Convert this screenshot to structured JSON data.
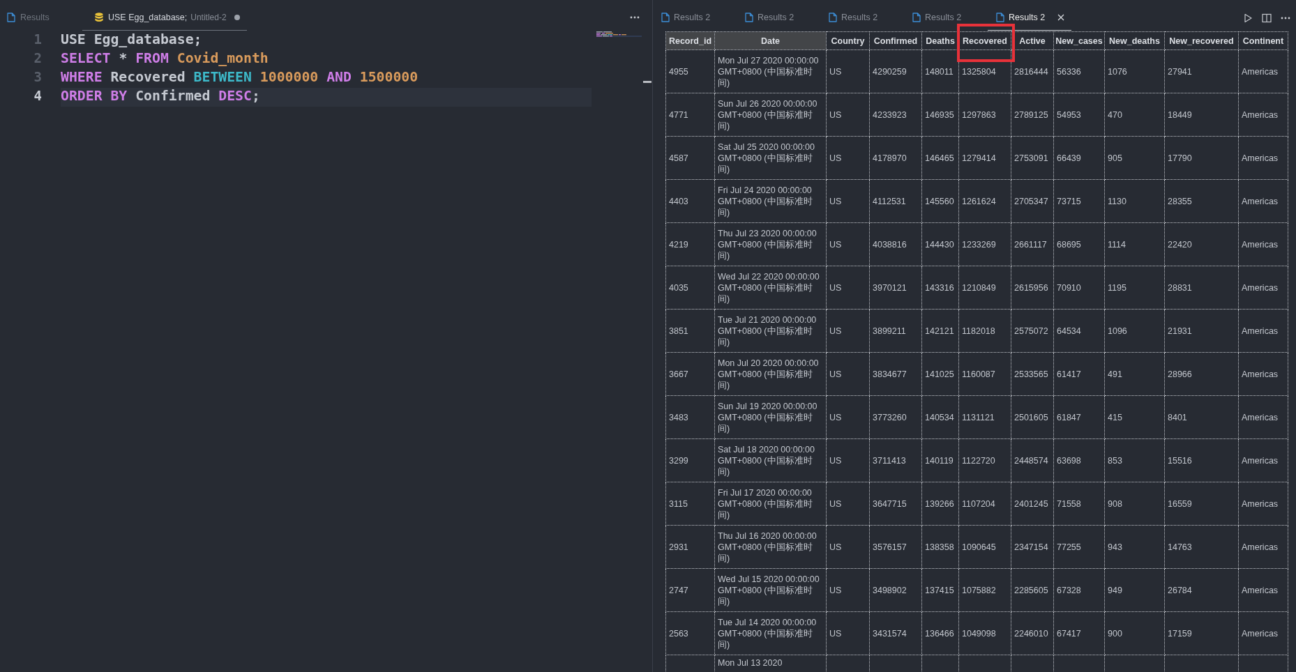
{
  "editor_tabs": [
    {
      "label": "Results",
      "kind": "results",
      "selected": false,
      "modified": false
    },
    {
      "label": "USE Egg_database;",
      "description": "Untitled-2",
      "kind": "query",
      "selected": true,
      "modified": true
    }
  ],
  "editor": {
    "lines": [
      {
        "number": "1",
        "current": false,
        "tokens": [
          {
            "text": "USE Egg_database;",
            "kind": "plain"
          }
        ]
      },
      {
        "number": "2",
        "current": false,
        "tokens": [
          {
            "text": "SELECT",
            "kind": "keyword"
          },
          {
            "text": " * ",
            "kind": "plain"
          },
          {
            "text": "FROM",
            "kind": "keyword"
          },
          {
            "text": " Covid_month",
            "kind": "name"
          }
        ]
      },
      {
        "number": "3",
        "current": false,
        "tokens": [
          {
            "text": "WHERE",
            "kind": "keyword"
          },
          {
            "text": " Recovered ",
            "kind": "plain"
          },
          {
            "text": "BETWEEN",
            "kind": "operator"
          },
          {
            "text": " 1000000",
            "kind": "number"
          },
          {
            "text": " AND",
            "kind": "keyword"
          },
          {
            "text": " 1500000",
            "kind": "number"
          }
        ]
      },
      {
        "number": "4",
        "current": true,
        "tokens": [
          {
            "text": "ORDER BY",
            "kind": "keyword"
          },
          {
            "text": " Confirmed ",
            "kind": "plain"
          },
          {
            "text": "DESC",
            "kind": "keyword"
          },
          {
            "text": ";",
            "kind": "plain"
          }
        ]
      }
    ]
  },
  "result_tabs": [
    {
      "label": "Results 2",
      "selected": false
    },
    {
      "label": "Results 2",
      "selected": false
    },
    {
      "label": "Results 2",
      "selected": false
    },
    {
      "label": "Results 2",
      "selected": false
    },
    {
      "label": "Results 2",
      "selected": true
    }
  ],
  "table": {
    "columns": [
      {
        "label": "Record_id",
        "shaded": true,
        "highlighted": false
      },
      {
        "label": "Date",
        "shaded": true,
        "highlighted": false
      },
      {
        "label": "Country",
        "shaded": false,
        "highlighted": false
      },
      {
        "label": "Confirmed",
        "shaded": false,
        "highlighted": false
      },
      {
        "label": "Deaths",
        "shaded": false,
        "highlighted": false
      },
      {
        "label": "Recovered",
        "shaded": false,
        "highlighted": true
      },
      {
        "label": "Active",
        "shaded": false,
        "highlighted": false
      },
      {
        "label": "New_cases",
        "shaded": false,
        "highlighted": false
      },
      {
        "label": "New_deaths",
        "shaded": false,
        "highlighted": false
      },
      {
        "label": "New_recovered",
        "shaded": false,
        "highlighted": false
      },
      {
        "label": "Continent",
        "shaded": false,
        "highlighted": false
      }
    ],
    "rows": [
      {
        "cells": [
          "4955",
          "Mon Jul 27 2020 00:00:00 GMT+0800 (中国标准时间)",
          "US",
          "4290259",
          "148011",
          "1325804",
          "2816444",
          "56336",
          "1076",
          "27941",
          "Americas"
        ]
      },
      {
        "cells": [
          "4771",
          "Sun Jul 26 2020 00:00:00 GMT+0800 (中国标准时间)",
          "US",
          "4233923",
          "146935",
          "1297863",
          "2789125",
          "54953",
          "470",
          "18449",
          "Americas"
        ]
      },
      {
        "cells": [
          "4587",
          "Sat Jul 25 2020 00:00:00 GMT+0800 (中国标准时间)",
          "US",
          "4178970",
          "146465",
          "1279414",
          "2753091",
          "66439",
          "905",
          "17790",
          "Americas"
        ]
      },
      {
        "cells": [
          "4403",
          "Fri Jul 24 2020 00:00:00 GMT+0800 (中国标准时间)",
          "US",
          "4112531",
          "145560",
          "1261624",
          "2705347",
          "73715",
          "1130",
          "28355",
          "Americas"
        ]
      },
      {
        "cells": [
          "4219",
          "Thu Jul 23 2020 00:00:00 GMT+0800 (中国标准时间)",
          "US",
          "4038816",
          "144430",
          "1233269",
          "2661117",
          "68695",
          "1114",
          "22420",
          "Americas"
        ]
      },
      {
        "cells": [
          "4035",
          "Wed Jul 22 2020 00:00:00 GMT+0800 (中国标准时间)",
          "US",
          "3970121",
          "143316",
          "1210849",
          "2615956",
          "70910",
          "1195",
          "28831",
          "Americas"
        ]
      },
      {
        "cells": [
          "3851",
          "Tue Jul 21 2020 00:00:00 GMT+0800 (中国标准时间)",
          "US",
          "3899211",
          "142121",
          "1182018",
          "2575072",
          "64534",
          "1096",
          "21931",
          "Americas"
        ]
      },
      {
        "cells": [
          "3667",
          "Mon Jul 20 2020 00:00:00 GMT+0800 (中国标准时间)",
          "US",
          "3834677",
          "141025",
          "1160087",
          "2533565",
          "61417",
          "491",
          "28966",
          "Americas"
        ]
      },
      {
        "cells": [
          "3483",
          "Sun Jul 19 2020 00:00:00 GMT+0800 (中国标准时间)",
          "US",
          "3773260",
          "140534",
          "1131121",
          "2501605",
          "61847",
          "415",
          "8401",
          "Americas"
        ]
      },
      {
        "cells": [
          "3299",
          "Sat Jul 18 2020 00:00:00 GMT+0800 (中国标准时间)",
          "US",
          "3711413",
          "140119",
          "1122720",
          "2448574",
          "63698",
          "853",
          "15516",
          "Americas"
        ]
      },
      {
        "cells": [
          "3115",
          "Fri Jul 17 2020 00:00:00 GMT+0800 (中国标准时间)",
          "US",
          "3647715",
          "139266",
          "1107204",
          "2401245",
          "71558",
          "908",
          "16559",
          "Americas"
        ]
      },
      {
        "cells": [
          "2931",
          "Thu Jul 16 2020 00:00:00 GMT+0800 (中国标准时间)",
          "US",
          "3576157",
          "138358",
          "1090645",
          "2347154",
          "77255",
          "943",
          "14763",
          "Americas"
        ]
      },
      {
        "cells": [
          "2747",
          "Wed Jul 15 2020 00:00:00 GMT+0800 (中国标准时间)",
          "US",
          "3498902",
          "137415",
          "1075882",
          "2285605",
          "67328",
          "949",
          "26784",
          "Americas"
        ]
      },
      {
        "cells": [
          "2563",
          "Tue Jul 14 2020 00:00:00 GMT+0800 (中国标准时间)",
          "US",
          "3431574",
          "136466",
          "1049098",
          "2246010",
          "67417",
          "900",
          "17159",
          "Americas"
        ]
      }
    ],
    "cut_row": {
      "date": "Mon Jul 13 2020"
    }
  }
}
